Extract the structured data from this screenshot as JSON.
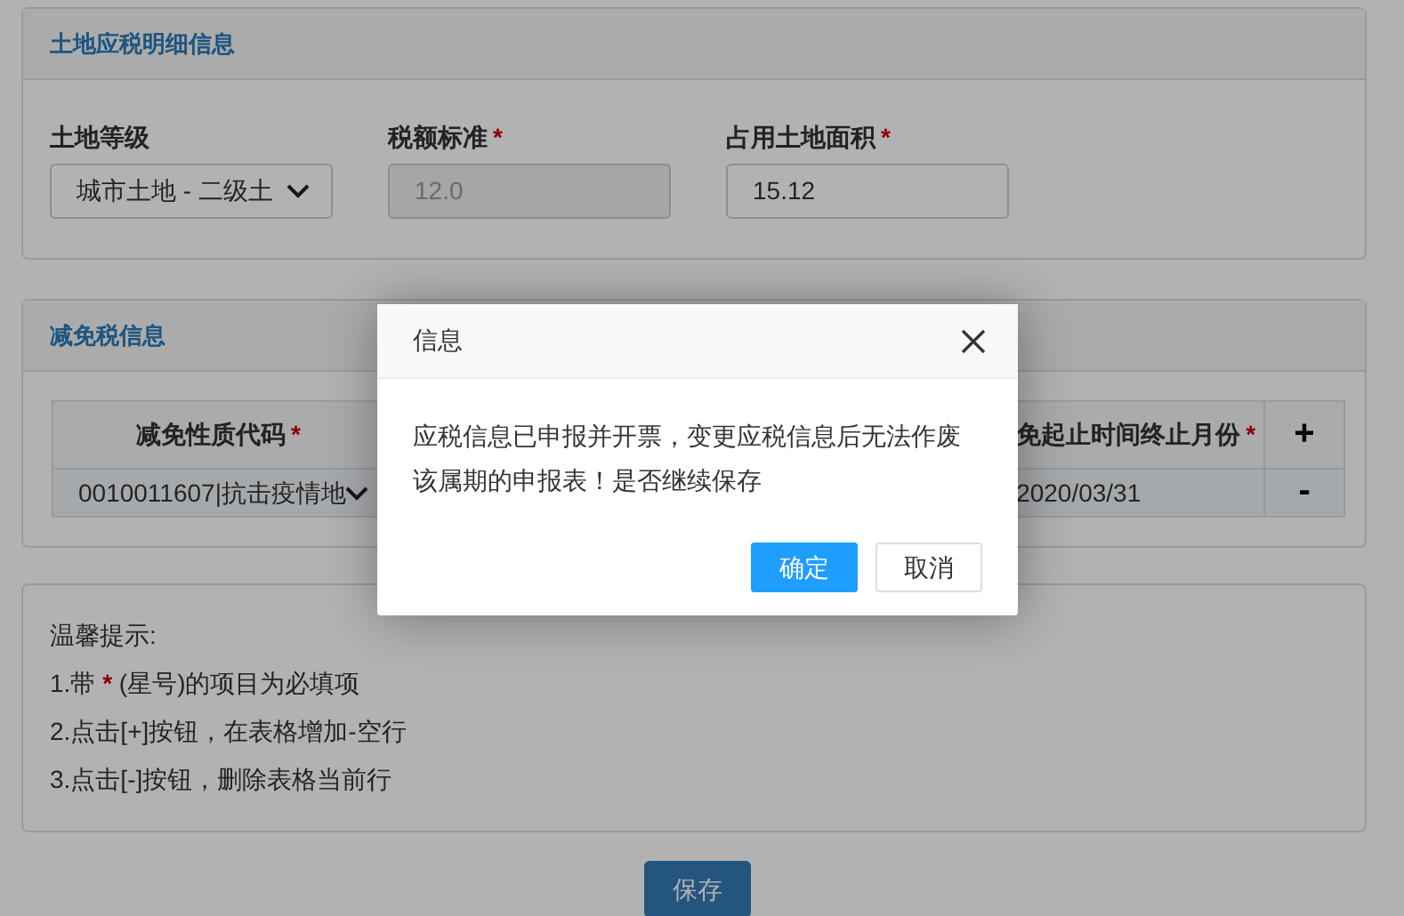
{
  "land_section": {
    "title": "土地应税明细信息",
    "fields": [
      {
        "label": "土地等级",
        "kind": "select",
        "value": "城市土地 - 二级土"
      },
      {
        "label": "税额标准",
        "mark": "*",
        "kind": "input",
        "value": "12.0",
        "disabled": true
      },
      {
        "label": "占用土地面积",
        "mark": "*",
        "kind": "input",
        "value": "15.12",
        "disabled": false
      }
    ]
  },
  "relief_section": {
    "title": "减免税信息",
    "columns": [
      {
        "label": "减免性质代码",
        "mark": "*"
      },
      {
        "label": "免起止时间终止月份",
        "mark": "*"
      }
    ],
    "add_button": "+",
    "rows": [
      {
        "code": "0010011607|抗击疫情地",
        "end_month": "2020/03/31",
        "remove_button": "-"
      }
    ]
  },
  "tips": {
    "title": "温馨提示:",
    "items": [
      {
        "before": "1.带",
        "star": "*",
        "after": "(星号)的项目为必填项"
      },
      {
        "before": "2.点击[+]按钮，在表格增加-空行"
      },
      {
        "before": "3.点击[-]按钮，删除表格当前行"
      }
    ]
  },
  "save_button": "保存",
  "dialog": {
    "title": "信息",
    "message": "应税信息已申报并开票，变更应税信息后无法作废该属期的申报表！是否继续保存",
    "buttons": [
      {
        "label": "确定",
        "kind": "primary"
      },
      {
        "label": "取消",
        "kind": "default"
      }
    ]
  }
}
